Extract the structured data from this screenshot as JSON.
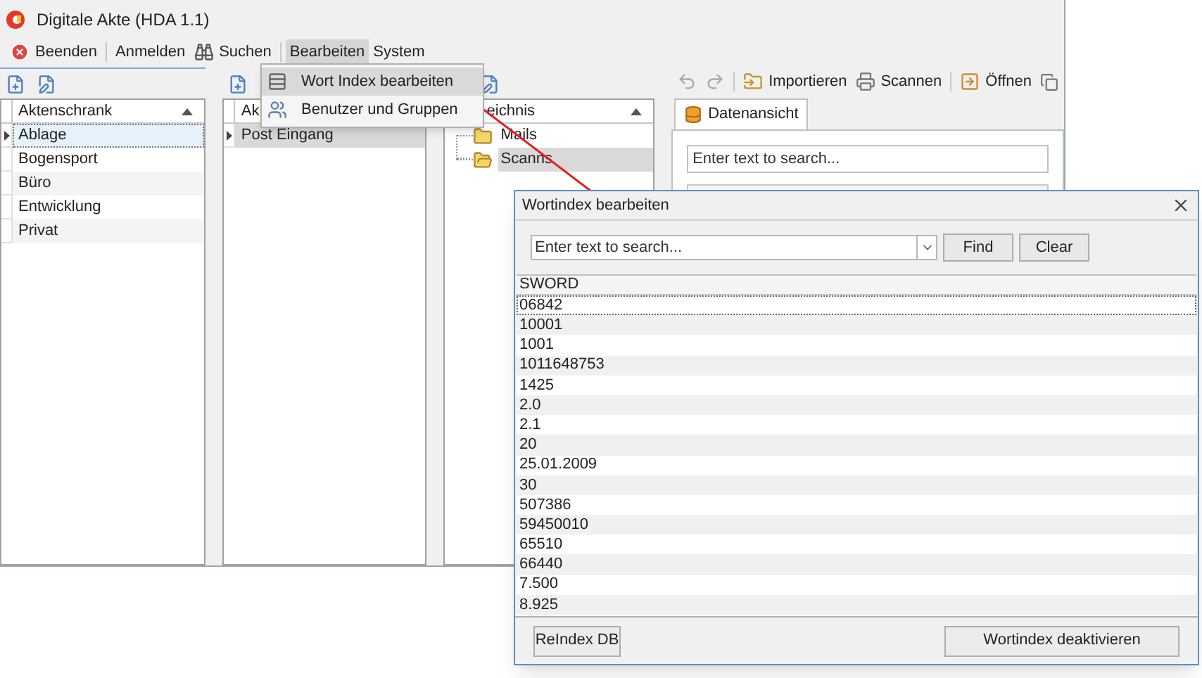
{
  "window": {
    "title": "Digitale Akte (HDA 1.1)"
  },
  "menu_bar": [
    {
      "label": "Beenden",
      "kind": "quit",
      "selected": false
    },
    {
      "label": "Anmelden",
      "kind": "plain",
      "selected": false
    },
    {
      "label": "Suchen",
      "kind": "search",
      "selected": false
    },
    {
      "label": "Bearbeiten",
      "kind": "plain",
      "selected": true
    },
    {
      "label": "System",
      "kind": "plain",
      "selected": false
    }
  ],
  "dropdown_menu": [
    {
      "label": "Wort Index bearbeiten",
      "kind": "index",
      "selected": true
    },
    {
      "label": "Benutzer und Gruppen",
      "kind": "users",
      "selected": false
    }
  ],
  "panes": [
    {
      "header": "Aktenschrank",
      "focused": true,
      "rows": [
        {
          "label": "Ablage",
          "selected": true
        },
        {
          "label": "Bogensport",
          "selected": false
        },
        {
          "label": "Büro",
          "selected": false
        },
        {
          "label": "Entwicklung",
          "selected": false
        },
        {
          "label": "Privat",
          "selected": false
        }
      ]
    },
    {
      "header": "Ak",
      "focused": false,
      "rows": [
        {
          "label": "Post Eingang",
          "selected": true
        }
      ]
    },
    {
      "header": "eichnis",
      "focused": false,
      "tree": [
        {
          "label": "Mails",
          "selected": false
        },
        {
          "label": "Scanns",
          "selected": true
        }
      ]
    }
  ],
  "viewer": {
    "toolbar": [
      {
        "label": "Importieren",
        "kind": "import"
      },
      {
        "label": "Scannen",
        "kind": "scan"
      },
      {
        "label": "Öffnen",
        "kind": "open"
      }
    ],
    "tab": {
      "label": "Datenansicht",
      "selected": true
    },
    "search": {
      "placeholder": "Enter text to search..."
    }
  },
  "dialog": {
    "title": "Wortindex bearbeiten",
    "search": {
      "placeholder": "Enter text to search..."
    },
    "buttons": [
      "Find",
      "Clear"
    ],
    "column": "SWORD",
    "rows": [
      {
        "value": "06842",
        "selected": true
      },
      {
        "value": "10001",
        "selected": false
      },
      {
        "value": "1001",
        "selected": false
      },
      {
        "value": "1011648753",
        "selected": false
      },
      {
        "value": "1425",
        "selected": false
      },
      {
        "value": "2.0",
        "selected": false
      },
      {
        "value": "2.1",
        "selected": false
      },
      {
        "value": "20",
        "selected": false
      },
      {
        "value": "25.01.2009",
        "selected": false
      },
      {
        "value": "30",
        "selected": false
      },
      {
        "value": "507386",
        "selected": false
      },
      {
        "value": "59450010",
        "selected": false
      },
      {
        "value": "65510",
        "selected": false
      },
      {
        "value": "66440",
        "selected": false
      },
      {
        "value": "7.500",
        "selected": false
      },
      {
        "value": "8.925",
        "selected": false
      }
    ],
    "footer_buttons": [
      "ReIndex DB",
      "Wortindex deaktivieren"
    ]
  }
}
